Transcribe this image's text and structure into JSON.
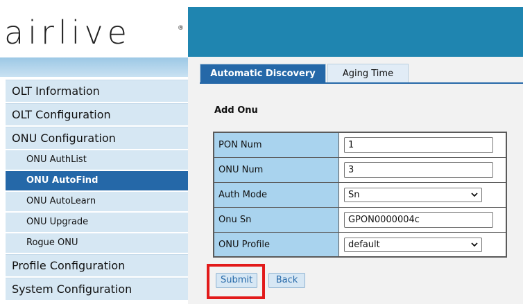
{
  "logo": {
    "text": "airlive",
    "registered": "®"
  },
  "sidebar": {
    "items": [
      {
        "label": "OLT Information",
        "type": "main"
      },
      {
        "label": "OLT Configuration",
        "type": "main"
      },
      {
        "label": "ONU Configuration",
        "type": "main"
      },
      {
        "label": "ONU AuthList",
        "type": "sub"
      },
      {
        "label": "ONU AutoFind",
        "type": "sub",
        "active": true
      },
      {
        "label": "ONU AutoLearn",
        "type": "sub"
      },
      {
        "label": "ONU Upgrade",
        "type": "sub"
      },
      {
        "label": "Rogue ONU",
        "type": "sub"
      },
      {
        "label": "Profile Configuration",
        "type": "main"
      },
      {
        "label": "System Configuration",
        "type": "main"
      }
    ]
  },
  "tabs": [
    {
      "label": "Automatic Discovery",
      "active": true
    },
    {
      "label": "Aging Time",
      "active": false
    }
  ],
  "section_title": "Add Onu",
  "form": {
    "pon_num": {
      "label": "PON Num",
      "value": "1"
    },
    "onu_num": {
      "label": "ONU Num",
      "value": "3"
    },
    "auth_mode": {
      "label": "Auth Mode",
      "value": "Sn"
    },
    "onu_sn": {
      "label": "Onu Sn",
      "value": "GPON0000004c"
    },
    "onu_profile": {
      "label": "ONU Profile",
      "value": "default"
    }
  },
  "buttons": {
    "submit": "Submit",
    "back": "Back"
  },
  "colors": {
    "banner": "#1f85b0",
    "active_nav": "#2568a8",
    "label_cell": "#a9d3ee",
    "highlight": "#e21a1a"
  }
}
